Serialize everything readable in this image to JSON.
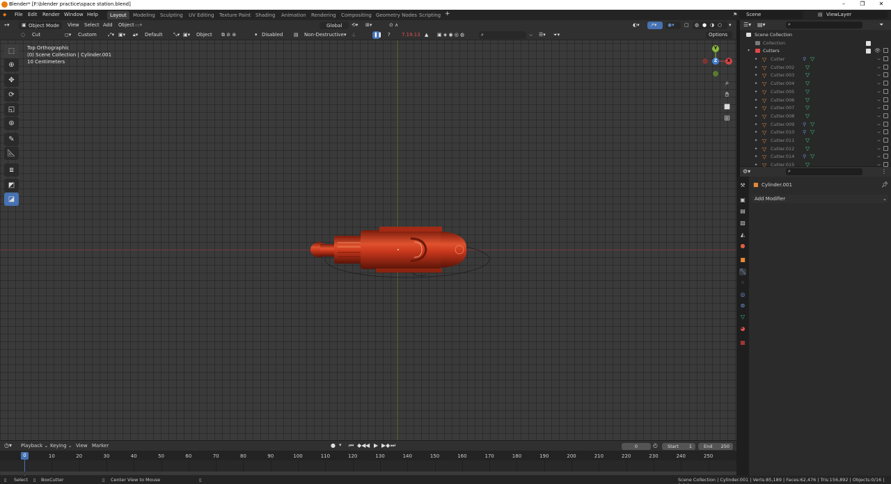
{
  "window": {
    "title": "Blender* [F:\\blender practice\\space station.blend]",
    "controls": [
      "–",
      "❐",
      "✕"
    ]
  },
  "menubar": {
    "menus": [
      "File",
      "Edit",
      "Render",
      "Window",
      "Help"
    ],
    "workspaces": [
      "Layout",
      "Modeling",
      "Sculpting",
      "UV Editing",
      "Texture Paint",
      "Shading",
      "Animation",
      "Rendering",
      "Compositing",
      "Geometry Nodes",
      "Scripting"
    ],
    "active_workspace": "Layout",
    "add_tab": "+",
    "scene_label": "Scene",
    "view_layer_label": "ViewLayer"
  },
  "viewport_header": {
    "mode": "Object Mode",
    "menus": [
      "View",
      "Select",
      "Add",
      "Object"
    ],
    "orientation": "Global",
    "shading_mode": "solid"
  },
  "tool_header": {
    "tool_name": "Cut",
    "shape": "Custom",
    "transform": "Default",
    "object": "Object",
    "display": "Disabled",
    "mode": "Non-Destructive",
    "version_text": "7.19.13",
    "options": "Options"
  },
  "viewport": {
    "view_name": "Top Orthographic",
    "collection_path": "(0) Scene Collection | Cylinder.001",
    "scale": "10 Centimeters",
    "gizmo": {
      "y": "Y",
      "z": "Z",
      "x": "X"
    }
  },
  "outliner": {
    "root": "Scene Collection",
    "collection": "Collection",
    "cutters_collection": "Cutters",
    "items": [
      "Cutter",
      "Cutter.002",
      "Cutter.003",
      "Cutter.004",
      "Cutter.005",
      "Cutter.006",
      "Cutter.007",
      "Cutter.008",
      "Cutter.009",
      "Cutter.010",
      "Cutter.011",
      "Cutter.012",
      "Cutter.014",
      "Cutter.015"
    ],
    "items_with_modifier": [
      "Cutter",
      "Cutter.009",
      "Cutter.010",
      "Cutter.014"
    ]
  },
  "properties": {
    "object_name": "Cylinder.001",
    "add_modifier": "Add Modifier",
    "active_tab": "modifier-tab"
  },
  "timeline": {
    "menus": [
      "Playback",
      "Keying",
      "View",
      "Marker"
    ],
    "current_frame": "0",
    "start_label": "Start",
    "start_value": "1",
    "end_label": "End",
    "end_value": "250",
    "ticks": [
      "0",
      "10",
      "20",
      "30",
      "40",
      "50",
      "60",
      "70",
      "80",
      "90",
      "100",
      "110",
      "120",
      "130",
      "140",
      "150",
      "160",
      "170",
      "180",
      "190",
      "200",
      "210",
      "220",
      "230",
      "240",
      "250"
    ]
  },
  "statusbar": {
    "select": "Select",
    "tool": "BoxCutter",
    "center_view": "Center View to Mouse",
    "stats": "Scene Collection | Cylinder.001 | Verts:85,189 | Faces:62,476 | Tris:156,892 | Objects:0/16 | 3.0.0"
  },
  "colors": {
    "accent": "#4772b3",
    "object": "#c8371c",
    "cutter_icon": "#e8883a",
    "mesh_icon": "#40c080"
  }
}
